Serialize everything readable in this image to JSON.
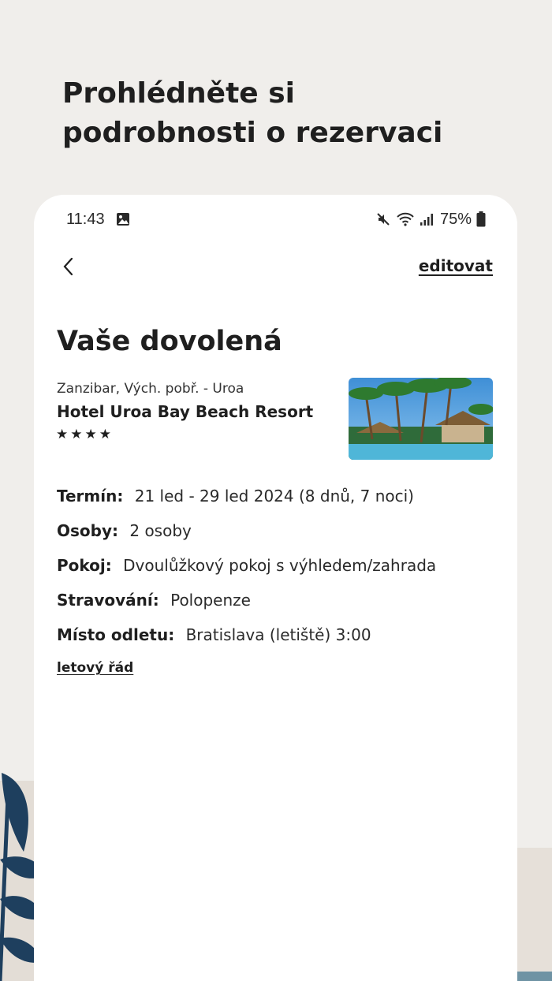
{
  "promo": {
    "line1": "Prohlédněte si",
    "line2": "podrobnosti o rezervaci"
  },
  "status_bar": {
    "time": "11:43",
    "battery": "75%",
    "icons": [
      "image-icon",
      "mute-icon",
      "wifi-icon",
      "signal-icon",
      "battery-icon"
    ]
  },
  "header": {
    "back_icon": "chevron-left-icon",
    "edit_label": "editovat"
  },
  "trip": {
    "title": "Vaše dovolená",
    "location": "Zanzibar, Vých. pobř. - Uroa",
    "hotel_name": "Hotel Uroa Bay Beach Resort",
    "stars": "★★★★",
    "star_count": 4
  },
  "details": {
    "term_label": "Termín:",
    "term_value": "21 led - 29 led 2024 (8 dnů, 7 noci)",
    "persons_label": "Osoby:",
    "persons_value": "2 osoby",
    "room_label": "Pokoj:",
    "room_value": "Dvoulůžkový pokoj s výhledem/zahrada",
    "board_label": "Stravování:",
    "board_value": "Polopenze",
    "departure_label": "Místo odletu:",
    "departure_value": "Bratislava (letiště) 3:00"
  },
  "flight_schedule_label": "letový řád",
  "colors": {
    "background": "#f0eeeb",
    "card": "#ffffff",
    "text": "#1f1f1f",
    "leaf": "#1e3f5e"
  }
}
